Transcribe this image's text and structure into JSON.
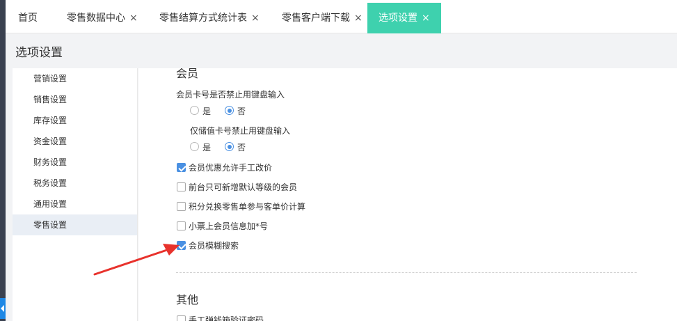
{
  "tabs": [
    {
      "label": "首页",
      "closable": false
    },
    {
      "label": "零售数据中心",
      "closable": true
    },
    {
      "label": "零售结算方式统计表",
      "closable": true
    },
    {
      "label": "零售客户端下载",
      "closable": true
    },
    {
      "label": "选项设置",
      "closable": true,
      "active": true
    }
  ],
  "close_glyph": "×",
  "page_title": "选项设置",
  "sidebar": {
    "items": [
      {
        "label": "营销设置"
      },
      {
        "label": "销售设置"
      },
      {
        "label": "库存设置"
      },
      {
        "label": "资金设置"
      },
      {
        "label": "财务设置"
      },
      {
        "label": "税务设置"
      },
      {
        "label": "通用设置"
      },
      {
        "label": "零售设置",
        "active": true
      }
    ]
  },
  "member_section": {
    "title": "会员",
    "card_keyboard": {
      "label": "会员卡号是否禁止用键盘输入",
      "yes_label": "是",
      "no_label": "否",
      "selected": "否"
    },
    "stored_card_keyboard": {
      "label": "仅储值卡号禁止用键盘输入",
      "yes_label": "是",
      "no_label": "否",
      "selected": "否"
    },
    "checkboxes": [
      {
        "label": "会员优惠允许手工改价",
        "checked": true
      },
      {
        "label": "前台只可新增默认等级的会员",
        "checked": false
      },
      {
        "label": "积分兑换零售单参与客单价计算",
        "checked": false
      },
      {
        "label": "小票上会员信息加*号",
        "checked": false
      },
      {
        "label": "会员模糊搜索",
        "checked": true
      }
    ]
  },
  "other_section": {
    "title": "其他",
    "checkboxes": [
      {
        "label": "手工弹钱箱验证密码",
        "checked": false
      }
    ]
  },
  "colors": {
    "active_tab": "#3ed1ae",
    "accent": "#4a90e2",
    "annotation_arrow": "#e8322c"
  }
}
